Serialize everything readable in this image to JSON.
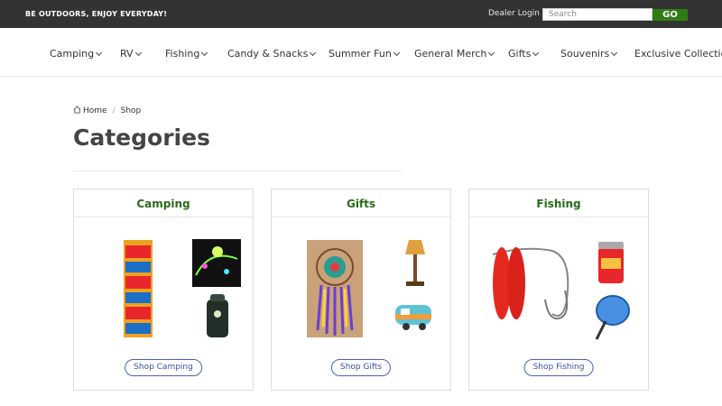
{
  "topbar": {
    "tagline": "BE OUTDOORS, ENJOY EVERYDAY!",
    "dealer_login": "Dealer Login",
    "search_placeholder": "Search",
    "go_label": "GO"
  },
  "nav": {
    "items": [
      "Camping",
      "RV",
      "Fishing",
      "Candy & Snacks",
      "Summer Fun",
      "General Merch",
      "Gifts",
      "Souvenirs",
      "Exclusive Collections"
    ]
  },
  "breadcrumb": {
    "home": "Home",
    "current": "Shop"
  },
  "page": {
    "title": "Categories"
  },
  "categories": [
    {
      "title": "Camping",
      "button": "Shop Camping"
    },
    {
      "title": "Gifts",
      "button": "Shop Gifts"
    },
    {
      "title": "Fishing",
      "button": "Shop Fishing"
    }
  ],
  "colors": {
    "topbar": "#333333",
    "go_button": "#2f7d12",
    "category_title": "#2b6a1a",
    "shop_button": "#3b52a8"
  }
}
